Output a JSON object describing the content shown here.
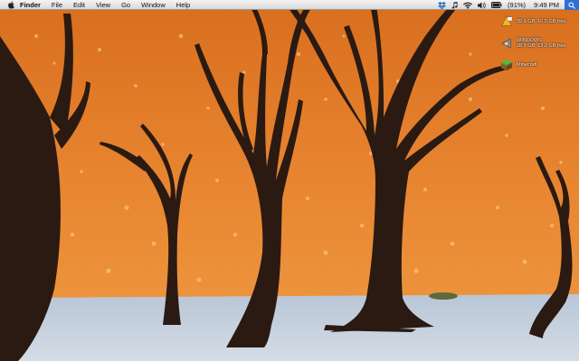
{
  "menubar": {
    "app_name": "Finder",
    "items": [
      "File",
      "Edit",
      "View",
      "Go",
      "Window",
      "Help"
    ],
    "battery_percent": "(91%)",
    "clock": "9:49 PM",
    "icons": [
      "apple-icon",
      "dropbox-icon",
      "music-icon",
      "wifi-icon",
      "volume-icon",
      "battery-icon",
      "spotlight-icon"
    ]
  },
  "desktop": {
    "icons": [
      {
        "name": "",
        "info": "39.9 GB, 10.5 GB free",
        "icon": "drive-icon"
      },
      {
        "name": "WINDOWS",
        "info": "28.9 GB, 13.2 GB free",
        "icon": "windows-drive-icon"
      },
      {
        "name": "Minecraft",
        "info": "",
        "icon": "minecraft-icon"
      }
    ]
  },
  "colors": {
    "sky_orange": "#e57a24",
    "dune_light": "#f19a3e",
    "ground": "#c8d3df",
    "tree": "#2a1a12"
  }
}
